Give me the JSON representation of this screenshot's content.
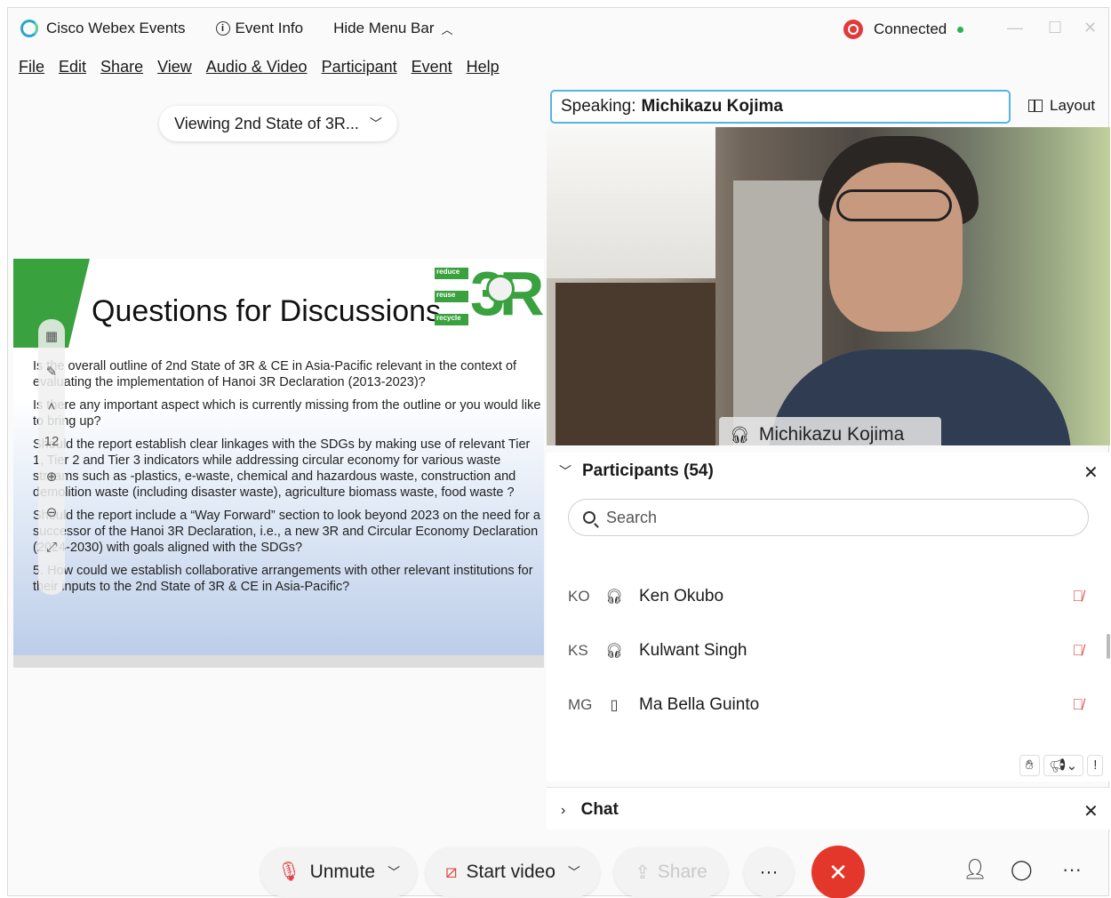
{
  "titlebar": {
    "app_name": "Cisco Webex Events",
    "event_info": "Event Info",
    "hide_menu": "Hide Menu Bar",
    "status": "Connected",
    "status_color": "#2cb24f"
  },
  "menu": [
    "File",
    "Edit",
    "Share",
    "View",
    "Audio & Video",
    "Participant",
    "Event",
    "Help"
  ],
  "stage": {
    "viewing_label": "Viewing 2nd State of 3R..."
  },
  "slide": {
    "title": "Questions for Discussions",
    "logo_tags": [
      "reduce",
      "reuse",
      "recycle"
    ],
    "logo_text": "3R",
    "tool_zoom": "12",
    "lines": [
      "Is the overall outline of 2nd State of 3R & CE in Asia-Pacific relevant in the context of evaluating the implementation of Hanoi 3R Declaration (2013-2023)?",
      "Is there any important aspect which is currently missing from the outline or you would like to bring up?",
      "Should the report establish clear linkages with the SDGs by making use of relevant Tier 1, Tier 2 and Tier 3 indicators while addressing circular economy for various waste streams such as -plastics, e-waste, chemical and hazardous waste, construction and demolition waste (including disaster waste), agriculture biomass waste, food waste ?",
      "Should the report include a “Way Forward” section to look beyond 2023 on the need for a successor of the Hanoi 3R Declaration, i.e., a new 3R and Circular Economy Declaration (2024-2030) with goals aligned with the SDGs?",
      "5. How could we establish collaborative arrangements with other relevant institutions for their inputs to the 2nd State of 3R & CE in Asia-Pacific?"
    ]
  },
  "video": {
    "speaking_label": "Speaking:",
    "speaker_name": "Michikazu Kojima",
    "layout_label": "Layout",
    "name_tag": "Michikazu Kojima"
  },
  "participants": {
    "header": "Participants (54)",
    "search_placeholder": "Search",
    "rows": [
      {
        "initials": "KO",
        "device": "headset",
        "name": "Ken Okubo",
        "muted": true
      },
      {
        "initials": "KS",
        "device": "headset",
        "name": "Kulwant Singh",
        "muted": true
      },
      {
        "initials": "MG",
        "device": "phone",
        "name": "Ma Bella Guinto",
        "muted": true
      }
    ]
  },
  "chat": {
    "label": "Chat"
  },
  "controls": {
    "unmute": "Unmute",
    "start_video": "Start video",
    "share": "Share",
    "end_color": "#e4372c"
  }
}
